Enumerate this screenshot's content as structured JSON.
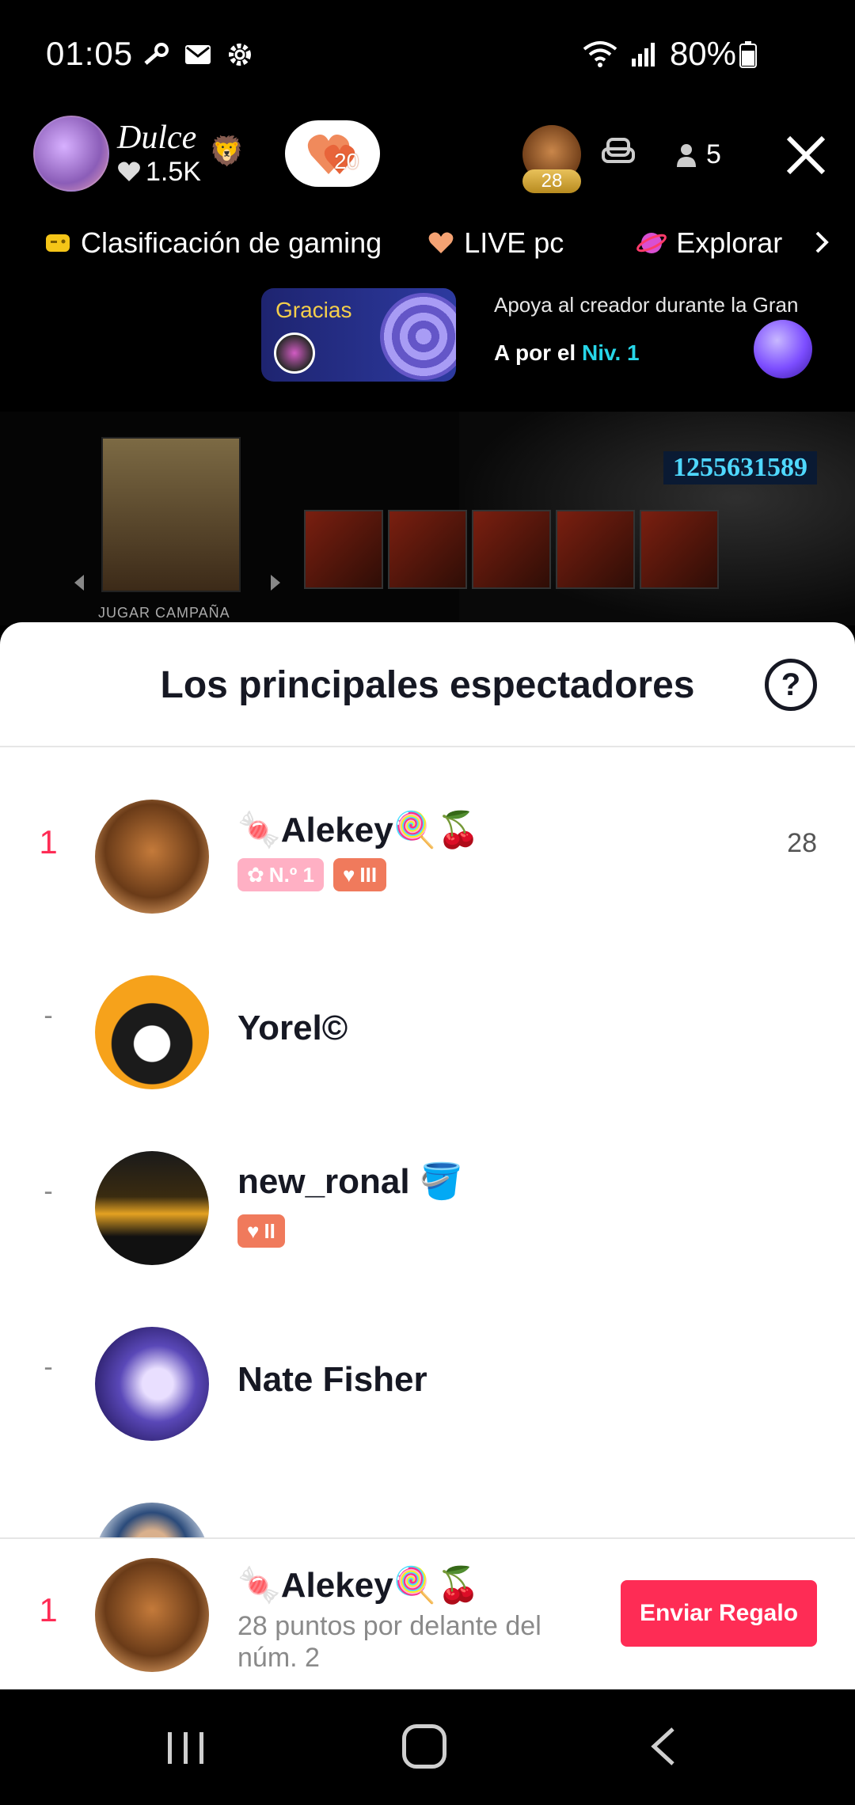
{
  "status_bar": {
    "time": "01:05",
    "battery": "80%"
  },
  "header": {
    "host_name": "Dulce",
    "host_likes": "1.5K",
    "fan_club_level": "20",
    "top_viewer_badge": "28",
    "viewer_count": "5"
  },
  "chips": [
    {
      "label": "Clasificación de gaming",
      "icon": "gamepad-icon"
    },
    {
      "label": "LIVE pc",
      "icon": "heart-icon"
    },
    {
      "label": "Explorar",
      "icon": "planet-icon"
    }
  ],
  "banner": {
    "gracias_label": "Gracias",
    "promo_text": "Apoya al creador durante la Gran",
    "goal_prefix": "A por el",
    "goal_level": "Niv. 1"
  },
  "stream": {
    "id": "1255631589",
    "caption": "JUGAR CAMPAÑA"
  },
  "sheet": {
    "title": "Los principales espectadores",
    "viewers": [
      {
        "rank": "1",
        "name": "🍬Alekey🍭🍒",
        "score": "28",
        "tags": [
          "N.º 1",
          "III"
        ]
      },
      {
        "rank": "-",
        "name": "Yorel©",
        "score": "",
        "tags": []
      },
      {
        "rank": "-",
        "name": "new_ronal 🪣",
        "score": "",
        "tags": [
          "II"
        ]
      },
      {
        "rank": "-",
        "name": "Nate Fisher",
        "score": "",
        "tags": []
      }
    ],
    "me": {
      "rank": "1",
      "name": "🍬Alekey🍭🍒",
      "subtitle": "28 puntos por delante del núm. 2",
      "button": "Enviar Regalo"
    }
  },
  "colors": {
    "accent": "#fe2c55",
    "level": "#27d6e8"
  }
}
